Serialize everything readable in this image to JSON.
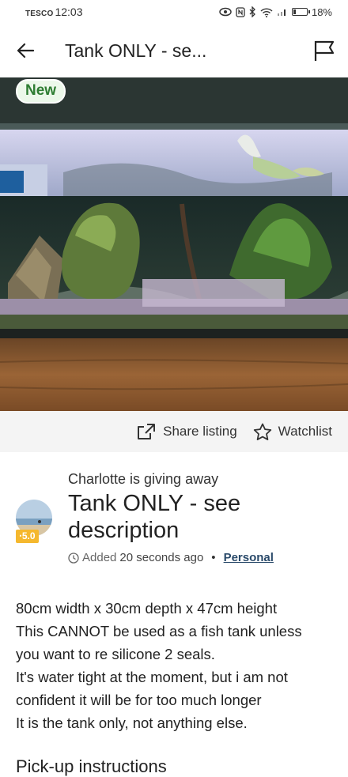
{
  "status_bar": {
    "carrier": "TESCO",
    "time": "12:03",
    "battery": "18%",
    "battery_level": 0.18
  },
  "header": {
    "title": "Tank ONLY - se..."
  },
  "photo": {
    "badge": "New"
  },
  "actions": {
    "share_label": "Share listing",
    "watch_label": "Watchlist"
  },
  "listing": {
    "giver_line": "Charlotte is giving away",
    "rating": "⋅5.0",
    "title": "Tank ONLY - see description",
    "added_prefix": "Added",
    "added_time": "20 seconds ago",
    "separator": "•",
    "tag": "Personal"
  },
  "description": [
    "80cm  width x 30cm depth x 47cm height",
    "This CANNOT be used as a fish tank unless",
    "you want to re silicone 2 seals.",
    "It's water tight at the moment, but i am not",
    "confident it will be for too much longer",
    "It is the tank only, not anything else."
  ],
  "pickup": {
    "heading": "Pick-up instructions"
  },
  "colors": {
    "badge_green": "#2e7d32",
    "rating_yellow": "#f5b82e",
    "link_blue": "#2a4a6a"
  }
}
